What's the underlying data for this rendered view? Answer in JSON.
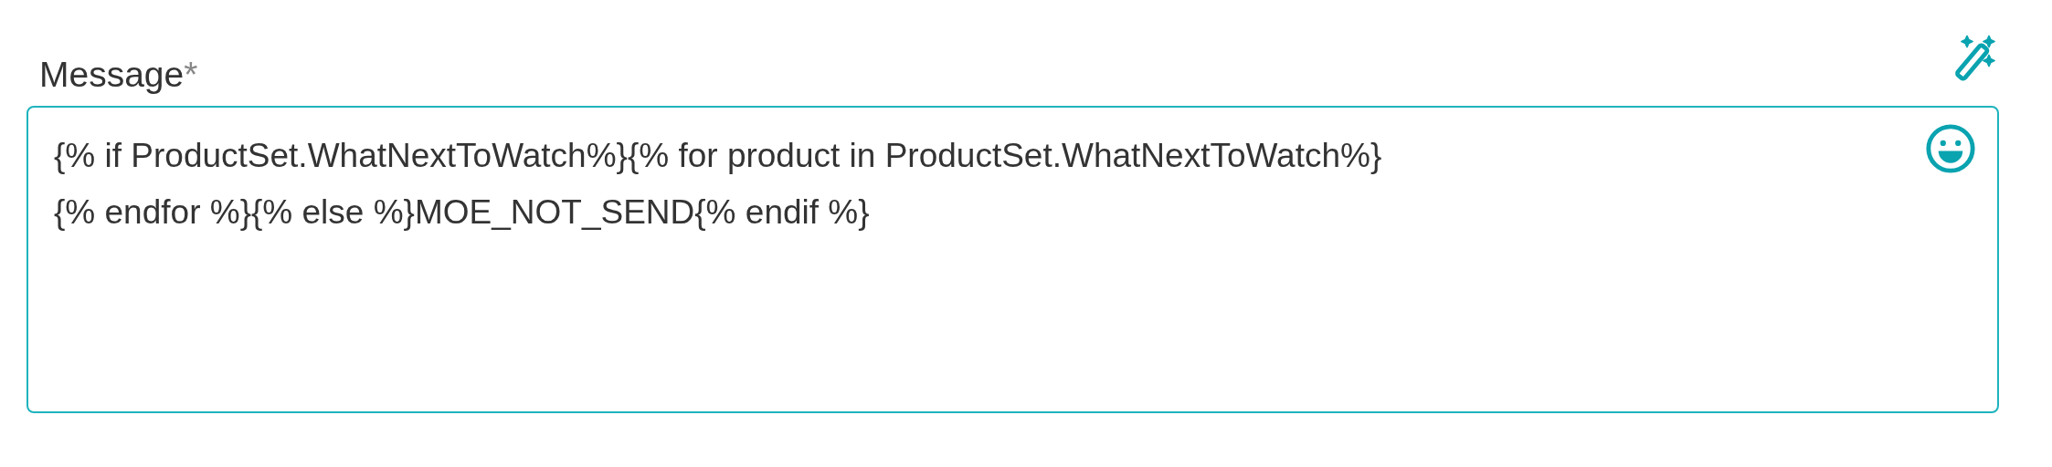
{
  "field": {
    "label": "Message",
    "required": true,
    "required_mark": "*",
    "value": "{% if ProductSet.WhatNextToWatch%}{% for product in ProductSet.WhatNextToWatch%}\n{% endfor %}{% else %}MOE_NOT_SEND{% endif %}"
  }
}
